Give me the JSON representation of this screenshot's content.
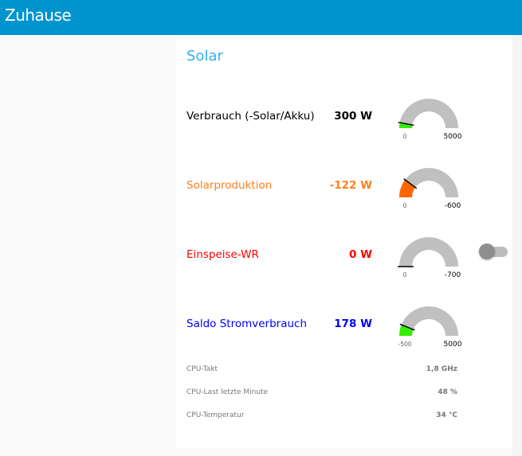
{
  "header": {
    "title": "Zuhause"
  },
  "card": {
    "title": "Solar",
    "rows": [
      {
        "label": "Verbrauch (-Solar/Akku)",
        "value": "300 W",
        "num": 300,
        "min": 0,
        "max": 5000,
        "min_label": "0",
        "max_label": "5000",
        "color": "#000000",
        "fill": "#33ee00"
      },
      {
        "label": "Solarproduktion",
        "value": "-122 W",
        "num": -122,
        "min": 0,
        "max": -600,
        "min_label": "0",
        "max_label": "-600",
        "color": "#ff7f1e",
        "fill": "#ff6600"
      },
      {
        "label": "Einspeise-WR",
        "value": "0 W",
        "num": 0,
        "min": 0,
        "max": -700,
        "min_label": "0",
        "max_label": "-700",
        "color": "#ff0000",
        "fill": "#33ee00"
      },
      {
        "label": "Saldo Stromverbrauch",
        "value": "178 W",
        "num": 178,
        "min": -500,
        "max": 5000,
        "min_label": "-500",
        "max_label": "5000",
        "color": "#0000ff",
        "fill": "#33ee00"
      }
    ],
    "toggle": {
      "on": false
    },
    "info": [
      {
        "label": "CPU-Takt",
        "value": "1,8 GHz"
      },
      {
        "label": "CPU-Last letzte Minute",
        "value": "48 %"
      },
      {
        "label": "CPU-Temperatur",
        "value": "34 °C"
      }
    ]
  }
}
